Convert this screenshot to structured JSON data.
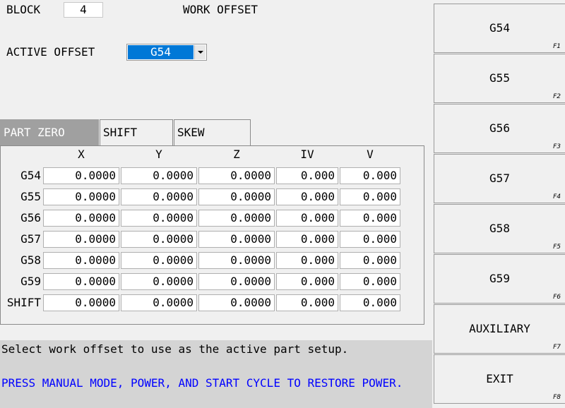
{
  "header": {
    "block_label": "BLOCK",
    "block_value": "4",
    "title": "WORK OFFSET",
    "active_offset_label": "ACTIVE OFFSET",
    "active_offset_value": "G54"
  },
  "tabs": [
    "PART ZERO",
    "SHIFT",
    "SKEW"
  ],
  "table": {
    "columns": [
      "X",
      "Y",
      "Z",
      "IV",
      "V"
    ],
    "rows": [
      {
        "label": "G54",
        "values": [
          "0.0000",
          "0.0000",
          "0.0000",
          "0.000",
          "0.000"
        ]
      },
      {
        "label": "G55",
        "values": [
          "0.0000",
          "0.0000",
          "0.0000",
          "0.000",
          "0.000"
        ]
      },
      {
        "label": "G56",
        "values": [
          "0.0000",
          "0.0000",
          "0.0000",
          "0.000",
          "0.000"
        ]
      },
      {
        "label": "G57",
        "values": [
          "0.0000",
          "0.0000",
          "0.0000",
          "0.000",
          "0.000"
        ]
      },
      {
        "label": "G58",
        "values": [
          "0.0000",
          "0.0000",
          "0.0000",
          "0.000",
          "0.000"
        ]
      },
      {
        "label": "G59",
        "values": [
          "0.0000",
          "0.0000",
          "0.0000",
          "0.000",
          "0.000"
        ]
      },
      {
        "label": "SHIFT",
        "values": [
          "0.0000",
          "0.0000",
          "0.0000",
          "0.000",
          "0.000"
        ]
      }
    ]
  },
  "status": {
    "help": "Select work offset to use as the active part setup.",
    "warning": "PRESS MANUAL MODE, POWER, AND START CYCLE TO RESTORE POWER."
  },
  "function_keys": [
    {
      "label": "G54",
      "key": "F1"
    },
    {
      "label": "G55",
      "key": "F2"
    },
    {
      "label": "G56",
      "key": "F3"
    },
    {
      "label": "G57",
      "key": "F4"
    },
    {
      "label": "G58",
      "key": "F5"
    },
    {
      "label": "G59",
      "key": "F6"
    },
    {
      "label": "AUXILIARY",
      "key": "F7"
    },
    {
      "label": "EXIT",
      "key": "F8"
    }
  ],
  "colors": {
    "background": "#f0f0f0",
    "selection": "#0078d7",
    "active_tab": "#a0a0a0",
    "status_bar": "#d4d4d4",
    "warning_text": "#0000ff"
  }
}
